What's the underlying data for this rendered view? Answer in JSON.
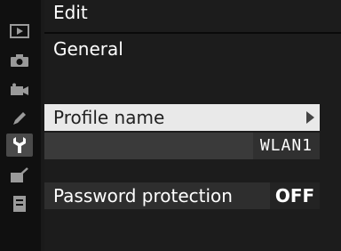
{
  "header": {
    "title": "Edit",
    "section": "General"
  },
  "menu": {
    "profile_label": "Profile name",
    "profile_value": "WLAN1",
    "password_label": "Password protection",
    "password_value": "OFF"
  },
  "sidebar": {
    "icons": [
      "playback-icon",
      "camera-icon",
      "movie-icon",
      "pencil-icon",
      "wrench-icon",
      "retouch-icon",
      "my-menu-icon"
    ],
    "active": "wrench-icon"
  },
  "colors": {
    "highlight_row": "#e9e9e9",
    "panel_bg": "#1c1c1c",
    "sidebar_bg": "#101010"
  }
}
